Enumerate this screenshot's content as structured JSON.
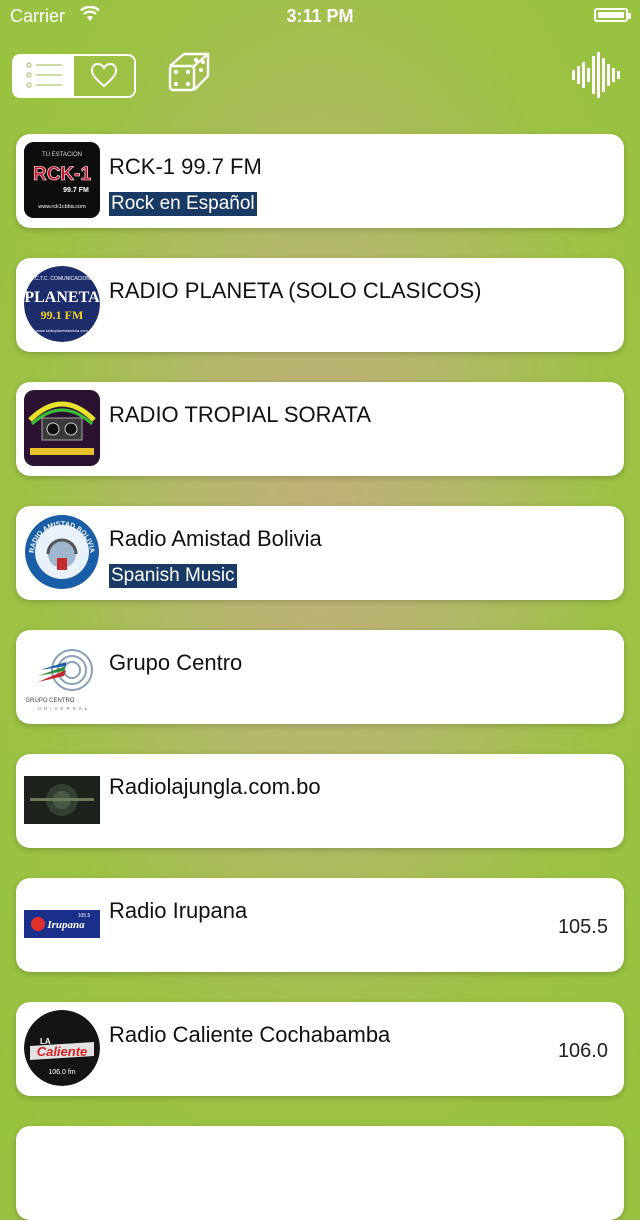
{
  "status_bar": {
    "carrier": "Carrier",
    "time": "3:11 PM"
  },
  "toolbar": {
    "list_icon": "list-icon",
    "favorites_icon": "heart-icon",
    "random_icon": "dice-icon",
    "player_icon": "waveform-icon"
  },
  "colors": {
    "background": "#9dc145",
    "highlight": "#1a3a66",
    "card": "#ffffff"
  },
  "stations": [
    {
      "name": "RCK-1 99.7 FM",
      "genre": "Rock en Español",
      "frequency": ""
    },
    {
      "name": "RADIO PLANETA (SOLO CLASICOS)",
      "genre": "",
      "frequency": ""
    },
    {
      "name": "RADIO TROPIAL SORATA",
      "genre": "",
      "frequency": ""
    },
    {
      "name": "Radio Amistad Bolivia",
      "genre": "Spanish Music",
      "frequency": ""
    },
    {
      "name": "Grupo Centro",
      "genre": "",
      "frequency": ""
    },
    {
      "name": "Radiolajungla.com.bo",
      "genre": "",
      "frequency": ""
    },
    {
      "name": "Radio Irupana",
      "genre": "",
      "frequency": "105.5"
    },
    {
      "name": "Radio Caliente Cochabamba",
      "genre": "",
      "frequency": "106.0"
    }
  ],
  "logos": {
    "rck1": {
      "top": "TU ESTACION",
      "main": "RCK-1",
      "sub": "99.7 FM",
      "url": "www.rck1cbba.com"
    },
    "planeta": {
      "top": "I.D.C.T.C. COMUNICACIONES",
      "main": "PLANETA",
      "sub": "99.1 FM",
      "url": "www.radioplanetabolivia.com"
    },
    "amistad": {
      "ring": "RADIO AMISTAD BOLIVIA"
    },
    "grupo_centro": {
      "line1": "GRUPO CENTRO",
      "line2": "UNIVERSAL"
    },
    "irupana": {
      "main": "Irupana",
      "sub": "105.5"
    },
    "caliente": {
      "top": "LA",
      "main": "Caliente",
      "sub": "106.0 fm"
    }
  }
}
